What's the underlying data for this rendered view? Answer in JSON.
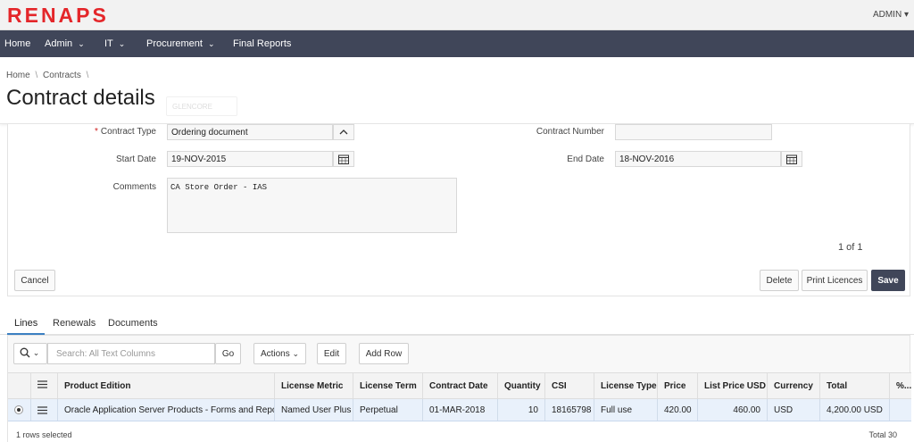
{
  "app": {
    "logo_text": "RENAPS",
    "brand_color": "#e4262a",
    "user_menu": "ADMIN",
    "user_menu_caret": "▾"
  },
  "nav": {
    "items": [
      {
        "label": "Home",
        "has_dropdown": false
      },
      {
        "label": "Admin",
        "has_dropdown": true
      },
      {
        "label": "IT",
        "has_dropdown": true
      },
      {
        "label": "Procurement",
        "has_dropdown": true
      },
      {
        "label": "Final Reports",
        "has_dropdown": false
      }
    ],
    "chevron": "⌄"
  },
  "header": {
    "breadcrumb": [
      "Home",
      "Contracts",
      ""
    ],
    "breadcrumb_sep": "\\",
    "title": "Contract details",
    "ghost_button": "GLENCORE"
  },
  "form": {
    "contract_type": {
      "label": "Contract Type",
      "required_mark": "*",
      "value": "Ordering document",
      "toggle": "^"
    },
    "contract_number": {
      "label": "Contract Number",
      "value": ""
    },
    "start_date": {
      "label": "Start Date",
      "value": "19-NOV-2015"
    },
    "end_date": {
      "label": "End Date",
      "value": "18-NOV-2016"
    },
    "comments": {
      "label": "Comments",
      "value": "CA Store Order - IAS"
    },
    "pager": "1 of 1",
    "buttons": {
      "cancel": "Cancel",
      "delete": "Delete",
      "print": "Print Licences",
      "save": "Save"
    }
  },
  "tabs": [
    {
      "label": "Lines",
      "active": true
    },
    {
      "label": "Renewals",
      "active": false
    },
    {
      "label": "Documents",
      "active": false
    }
  ],
  "report": {
    "search_placeholder": "Search: All Text Columns",
    "go": "Go",
    "actions": "Actions",
    "actions_caret": "⌄",
    "search_caret": "⌄",
    "edit": "Edit",
    "add_row": "Add Row",
    "columns": [
      "Product Edition",
      "License Metric",
      "License Term",
      "Contract Date",
      "Quantity",
      "CSI",
      "License Type",
      "Price",
      "List Price USD",
      "Currency",
      "Total",
      "%..."
    ],
    "rows": [
      {
        "product_edition": "Oracle Application Server Products - Forms and Reports",
        "license_metric": "Named User Plus",
        "license_term": "Perpetual",
        "contract_date": "01-MAR-2018",
        "quantity": "10",
        "csi": "18165798",
        "license_type": "Full use",
        "price": "420.00",
        "list_price_usd": "460.00",
        "currency": "USD",
        "total": "4,200.00 USD",
        "pct": ""
      }
    ],
    "footer_left": "1 rows selected",
    "footer_right": "Total 30"
  }
}
